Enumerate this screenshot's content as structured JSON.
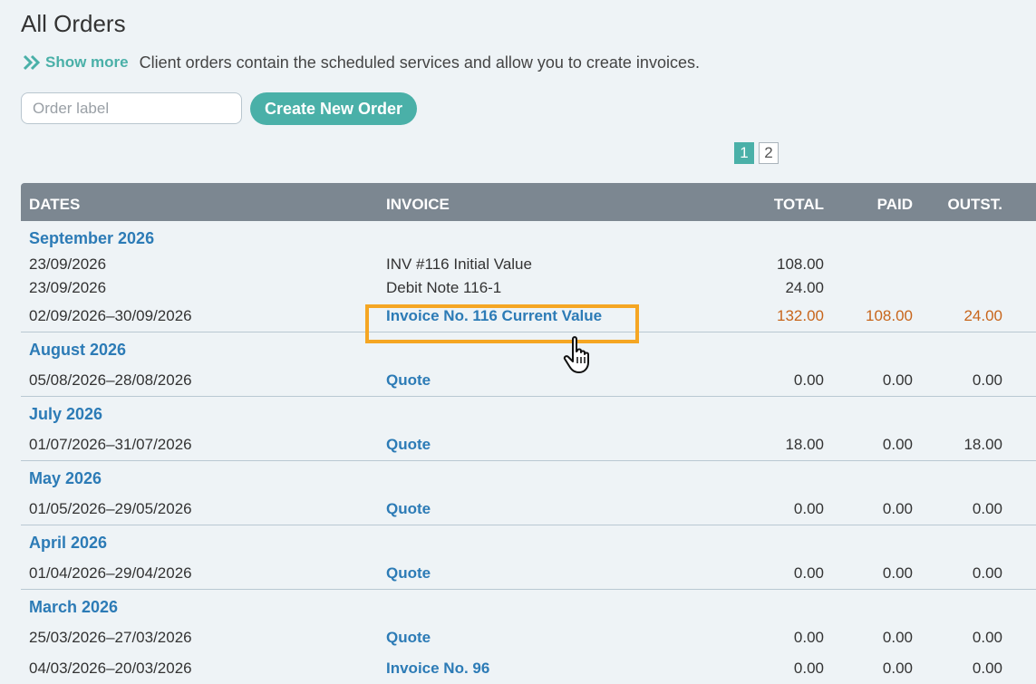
{
  "page": {
    "title": "All Orders",
    "show_more_label": "Show more",
    "intro_text": "Client orders contain the scheduled services and allow you to create invoices."
  },
  "controls": {
    "order_label_placeholder": "Order label",
    "order_label_value": "",
    "create_button_label": "Create New Order"
  },
  "pagination": {
    "pages": [
      "1",
      "2"
    ],
    "current": "1"
  },
  "table": {
    "headers": {
      "dates": "DATES",
      "invoice": "INVOICE",
      "total": "TOTAL",
      "paid": "PAID",
      "outst": "OUTST."
    },
    "groups": [
      {
        "month": "September 2026",
        "rows": [
          {
            "dates": "23/09/2026",
            "invoice": "INV #116 Initial Value",
            "total": "108.00",
            "paid": "",
            "outst": ""
          },
          {
            "dates": "23/09/2026",
            "invoice": "Debit Note 116-1",
            "total": "24.00",
            "paid": "",
            "outst": ""
          },
          {
            "dates": "02/09/2026–30/09/2026",
            "invoice": "Invoice No. 116 Current Value",
            "total": "132.00",
            "paid": "108.00",
            "outst": "24.00"
          }
        ]
      },
      {
        "month": "August 2026",
        "rows": [
          {
            "dates": "05/08/2026–28/08/2026",
            "invoice": "Quote",
            "total": "0.00",
            "paid": "0.00",
            "outst": "0.00"
          }
        ]
      },
      {
        "month": "July 2026",
        "rows": [
          {
            "dates": "01/07/2026–31/07/2026",
            "invoice": "Quote",
            "total": "18.00",
            "paid": "0.00",
            "outst": "18.00"
          }
        ]
      },
      {
        "month": "May 2026",
        "rows": [
          {
            "dates": "01/05/2026–29/05/2026",
            "invoice": "Quote",
            "total": "0.00",
            "paid": "0.00",
            "outst": "0.00"
          }
        ]
      },
      {
        "month": "April 2026",
        "rows": [
          {
            "dates": "01/04/2026–29/04/2026",
            "invoice": "Quote",
            "total": "0.00",
            "paid": "0.00",
            "outst": "0.00"
          }
        ]
      },
      {
        "month": "March 2026",
        "rows": [
          {
            "dates": "25/03/2026–27/03/2026",
            "invoice": "Quote",
            "total": "0.00",
            "paid": "0.00",
            "outst": "0.00"
          },
          {
            "dates": "04/03/2026–20/03/2026",
            "invoice": "Invoice No. 96",
            "total": "0.00",
            "paid": "0.00",
            "outst": "0.00"
          }
        ]
      }
    ]
  },
  "colors": {
    "accent": "#4ab0a8",
    "link": "#2c7bb6",
    "warning": "#c8651b",
    "highlight": "#f5a623",
    "header_bg": "#7c8791"
  },
  "icons": {
    "show_more": "double-chevron-right-icon",
    "cursor": "hand-pointer-icon"
  }
}
